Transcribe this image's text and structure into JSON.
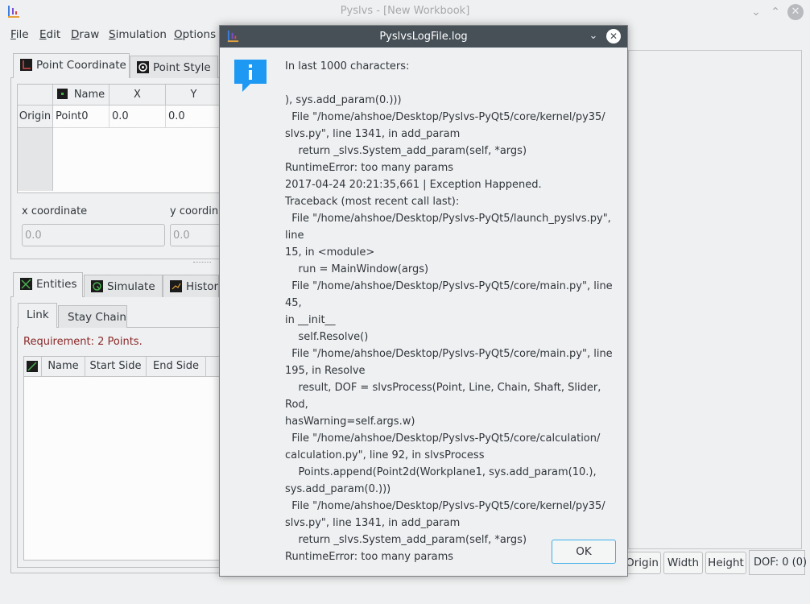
{
  "window": {
    "title": "Pyslvs - [New Workbook]",
    "min_icon": "chevron-down-icon",
    "max_icon": "chevron-up-icon",
    "close_icon": "close-icon",
    "min_glyph": "⌄",
    "max_glyph": "⌃",
    "close_glyph": "✕"
  },
  "menubar": [
    {
      "ul": "F",
      "rest": "ile"
    },
    {
      "ul": "E",
      "rest": "dit"
    },
    {
      "ul": "D",
      "rest": "raw"
    },
    {
      "ul": "S",
      "rest": "imulation"
    },
    {
      "ul": "O",
      "rest": "ptions"
    }
  ],
  "top_panel": {
    "tabs": [
      {
        "label": "Point Coordinate",
        "icon": "point-coordinate-icon"
      },
      {
        "label": "Point Style",
        "icon": "point-style-icon"
      }
    ],
    "table": {
      "headers": [
        "Name",
        "X",
        "Y"
      ],
      "rows": [
        {
          "row_header": "Origin",
          "name": "Point0",
          "x": "0.0",
          "y": "0.0"
        }
      ]
    },
    "x_label": "x coordinate",
    "y_label": "y coordina",
    "x_value": "0.0",
    "y_value": "0.0"
  },
  "bottom_panel": {
    "tabs": [
      {
        "label": "Entities",
        "icon": "entities-icon"
      },
      {
        "label": "Simulate",
        "icon": "simulate-icon"
      },
      {
        "label": "History",
        "icon": "history-icon"
      }
    ],
    "subtabs": [
      "Link",
      "Stay Chain"
    ],
    "requirement": "Requirement: 2 Points.",
    "headers": [
      "Name",
      "Start Side",
      "End Side"
    ]
  },
  "statusbar": {
    "buttons": [
      "Origin",
      "Width",
      "Height"
    ],
    "dof": "DOF: 0 (0)"
  },
  "dialog": {
    "title": "PyslvsLogFile.log",
    "chevron_glyph": "⌄",
    "close_glyph": "✕",
    "text": "In last 1000 characters:\n\n), sys.add_param(0.)))\n  File \"/home/ahshoe/Desktop/Pyslvs-PyQt5/core/kernel/py35/\nslvs.py\", line 1341, in add_param\n    return _slvs.System_add_param(self, *args)\nRuntimeError: too many params\n2017-04-24 20:21:35,661 | Exception Happened.\nTraceback (most recent call last):\n  File \"/home/ahshoe/Desktop/Pyslvs-PyQt5/launch_pyslvs.py\", line\n15, in <module>\n    run = MainWindow(args)\n  File \"/home/ahshoe/Desktop/Pyslvs-PyQt5/core/main.py\", line 45,\nin __init__\n    self.Resolve()\n  File \"/home/ahshoe/Desktop/Pyslvs-PyQt5/core/main.py\", line\n195, in Resolve\n    result, DOF = slvsProcess(Point, Line, Chain, Shaft, Slider, Rod,\nhasWarning=self.args.w)\n  File \"/home/ahshoe/Desktop/Pyslvs-PyQt5/core/calculation/\ncalculation.py\", line 92, in slvsProcess\n    Points.append(Point2d(Workplane1, sys.add_param(10.),\nsys.add_param(0.)))\n  File \"/home/ahshoe/Desktop/Pyslvs-PyQt5/core/kernel/py35/\nslvs.py\", line 1341, in add_param\n    return _slvs.System_add_param(self, *args)\nRuntimeError: too many params",
    "ok_label": "OK",
    "icon": "info-icon"
  },
  "colors": {
    "accent": "#3daee9",
    "requirement_text": "#8b2a2a",
    "dialog_titlebar": "#475057",
    "info_icon": "#1d99f3"
  }
}
